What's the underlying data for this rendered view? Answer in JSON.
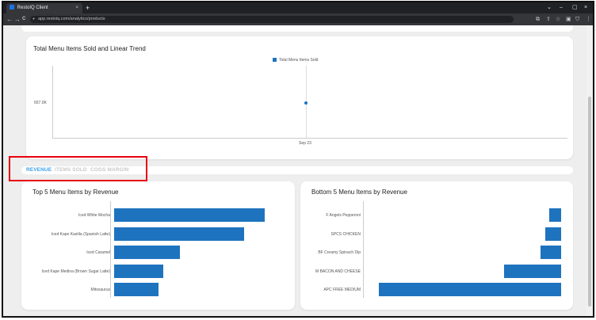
{
  "browser": {
    "tab_title": "RestoIQ Client",
    "tab_close": "×",
    "new_tab": "+",
    "url": "app.restoiq.com/analytics/products",
    "window_controls": [
      "⌄",
      "–",
      "▢",
      "×"
    ],
    "nav": [
      "←",
      "→",
      "C"
    ],
    "toolbar_icons": [
      "⧉",
      "⇪",
      "☆",
      "▣",
      "⛉",
      "⋮"
    ]
  },
  "trend_card": {
    "title": "Total Menu Items Sold and Linear Trend",
    "legend": "Total Menu Items Sold",
    "y_tick": "657.0K",
    "x_tick": "Sep 23"
  },
  "kpi_tabs": [
    {
      "label": "REVENUE",
      "active": true
    },
    {
      "label": "ITEMS SOLD",
      "active": false
    },
    {
      "label": "COGS MARGIN",
      "active": false
    }
  ],
  "colors": {
    "bar": "#1e73be",
    "active_tab": "#3aa0e8",
    "inactive_tab": "#c8c8c8",
    "highlight": "#e8000b"
  },
  "top5": {
    "title": "Top 5 Menu Items by Revenue",
    "items": [
      {
        "label": "Iced White Mocha",
        "value": 189
      },
      {
        "label": "Iced Kape Kastila (Spanish Latte)",
        "value": 163
      },
      {
        "label": "Iced Caramel",
        "value": 83
      },
      {
        "label": "Iced Kape Medina (Brown Sugar Latte)",
        "value": 62
      },
      {
        "label": "Mitosaurus",
        "value": 56
      }
    ]
  },
  "bottom5": {
    "title": "Bottom 5 Menu Items by Revenue",
    "items": [
      {
        "label": "F Angels Pepperoni",
        "value": 15
      },
      {
        "label": "SPCS CHICKEN",
        "value": 20
      },
      {
        "label": "BF Creamy Spinach Dip",
        "value": 26
      },
      {
        "label": "M BACON AND CHEESE",
        "value": 72
      },
      {
        "label": "APC FREE MEDIUM",
        "value": 230
      }
    ]
  }
}
